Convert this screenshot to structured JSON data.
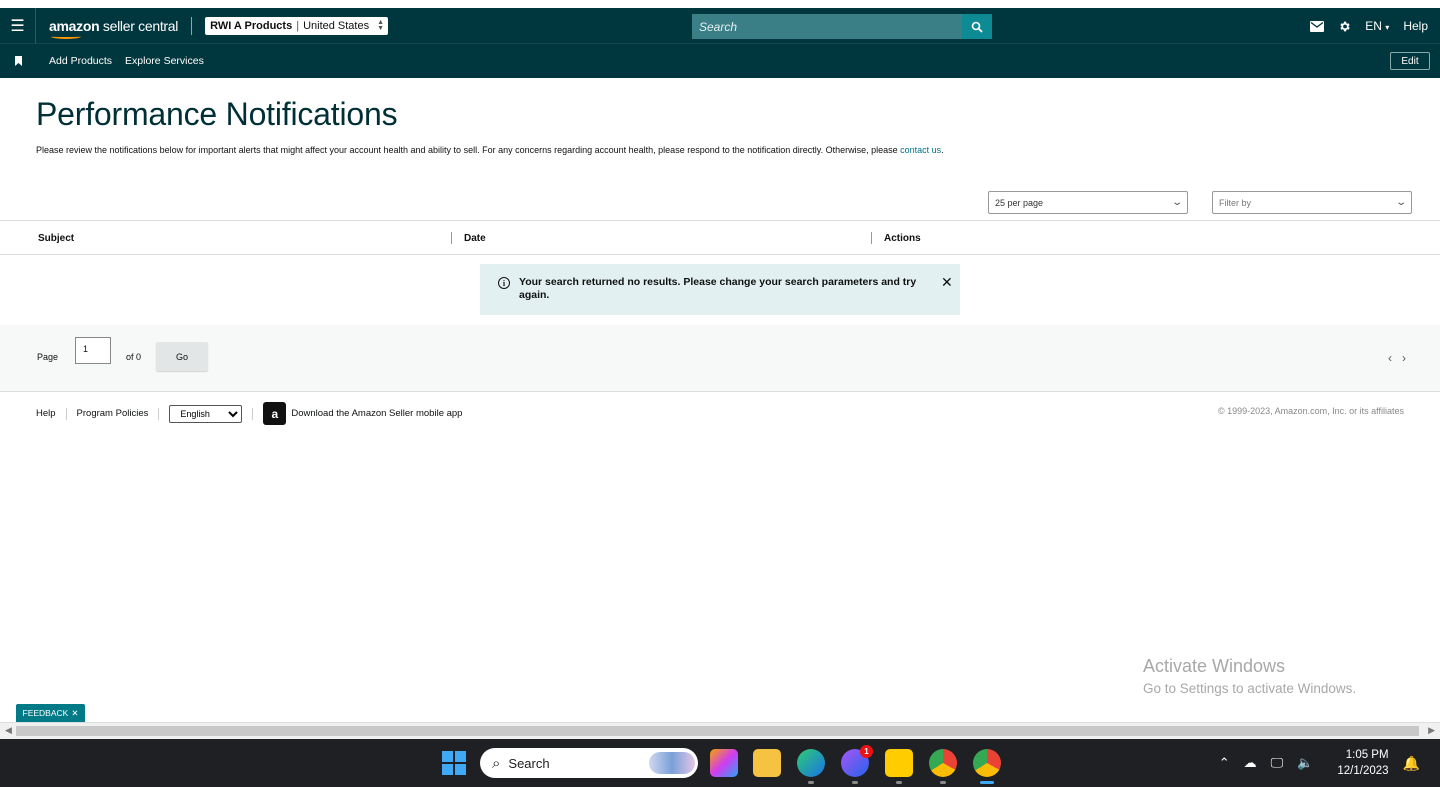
{
  "topnav": {
    "brand_bold": "amazon",
    "brand_rest": " seller central",
    "account_name": "RWI A Products",
    "account_region": "United States",
    "search_placeholder": "Search",
    "language": "EN",
    "help": "Help"
  },
  "subnav": {
    "links": [
      "Add Products",
      "Explore Services"
    ],
    "edit_label": "Edit"
  },
  "page": {
    "title": "Performance Notifications",
    "description": "Please review the notifications below for important alerts that might affect your account health and ability to sell. For any concerns regarding account health, please respond to the notification directly. Otherwise, please ",
    "contact_link": "contact us",
    "description_end": "."
  },
  "filters": {
    "per_page": "25 per page",
    "filter_by": "Filter by"
  },
  "table": {
    "columns": [
      "Subject",
      "Date",
      "Actions"
    ],
    "no_results": "Your search returned no results. Please change your search parameters and try again."
  },
  "pager": {
    "page_label": "Page",
    "page_value": "1",
    "of_label": "of 0",
    "go_label": "Go"
  },
  "footer": {
    "help": "Help",
    "program_policies": "Program Policies",
    "language_option": "English",
    "app_link": "Download the Amazon Seller mobile app",
    "copyright": "© 1999-2023, Amazon.com, Inc. or its affiliates"
  },
  "feedback_label": "FEEDBACK",
  "watermark": {
    "line1": "Activate Windows",
    "line2": "Go to Settings to activate Windows."
  },
  "taskbar": {
    "search_label": "Search",
    "messenger_badge": "1",
    "time": "1:05 PM",
    "date": "12/1/2023"
  },
  "colors": {
    "nav_bg": "#00363d",
    "accent": "#007185",
    "alert_bg": "#e3f0f1"
  }
}
